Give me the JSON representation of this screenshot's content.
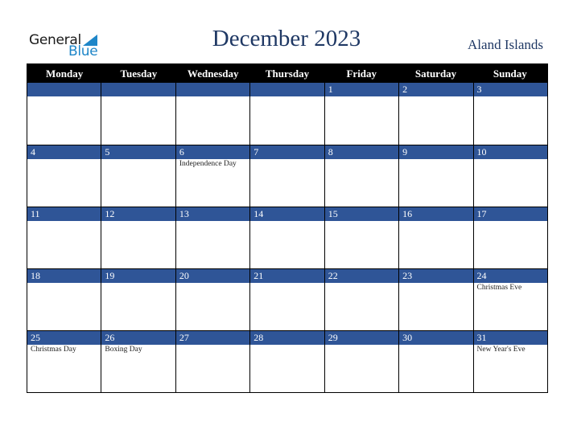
{
  "logo": {
    "line1": "General",
    "line2": "Blue"
  },
  "header": {
    "title": "December 2023",
    "country": "Aland Islands"
  },
  "colors": {
    "header_bg": "#000000",
    "date_bar": "#2f5597",
    "title": "#1f3864",
    "logo_blue": "#1e86c8"
  },
  "weekdays": [
    "Monday",
    "Tuesday",
    "Wednesday",
    "Thursday",
    "Friday",
    "Saturday",
    "Sunday"
  ],
  "weeks": [
    [
      {
        "day": "",
        "holiday": ""
      },
      {
        "day": "",
        "holiday": ""
      },
      {
        "day": "",
        "holiday": ""
      },
      {
        "day": "",
        "holiday": ""
      },
      {
        "day": "1",
        "holiday": ""
      },
      {
        "day": "2",
        "holiday": ""
      },
      {
        "day": "3",
        "holiday": ""
      }
    ],
    [
      {
        "day": "4",
        "holiday": ""
      },
      {
        "day": "5",
        "holiday": ""
      },
      {
        "day": "6",
        "holiday": "Independence Day"
      },
      {
        "day": "7",
        "holiday": ""
      },
      {
        "day": "8",
        "holiday": ""
      },
      {
        "day": "9",
        "holiday": ""
      },
      {
        "day": "10",
        "holiday": ""
      }
    ],
    [
      {
        "day": "11",
        "holiday": ""
      },
      {
        "day": "12",
        "holiday": ""
      },
      {
        "day": "13",
        "holiday": ""
      },
      {
        "day": "14",
        "holiday": ""
      },
      {
        "day": "15",
        "holiday": ""
      },
      {
        "day": "16",
        "holiday": ""
      },
      {
        "day": "17",
        "holiday": ""
      }
    ],
    [
      {
        "day": "18",
        "holiday": ""
      },
      {
        "day": "19",
        "holiday": ""
      },
      {
        "day": "20",
        "holiday": ""
      },
      {
        "day": "21",
        "holiday": ""
      },
      {
        "day": "22",
        "holiday": ""
      },
      {
        "day": "23",
        "holiday": ""
      },
      {
        "day": "24",
        "holiday": "Christmas Eve"
      }
    ],
    [
      {
        "day": "25",
        "holiday": "Christmas Day"
      },
      {
        "day": "26",
        "holiday": "Boxing Day"
      },
      {
        "day": "27",
        "holiday": ""
      },
      {
        "day": "28",
        "holiday": ""
      },
      {
        "day": "29",
        "holiday": ""
      },
      {
        "day": "30",
        "holiday": ""
      },
      {
        "day": "31",
        "holiday": "New Year's Eve"
      }
    ]
  ]
}
